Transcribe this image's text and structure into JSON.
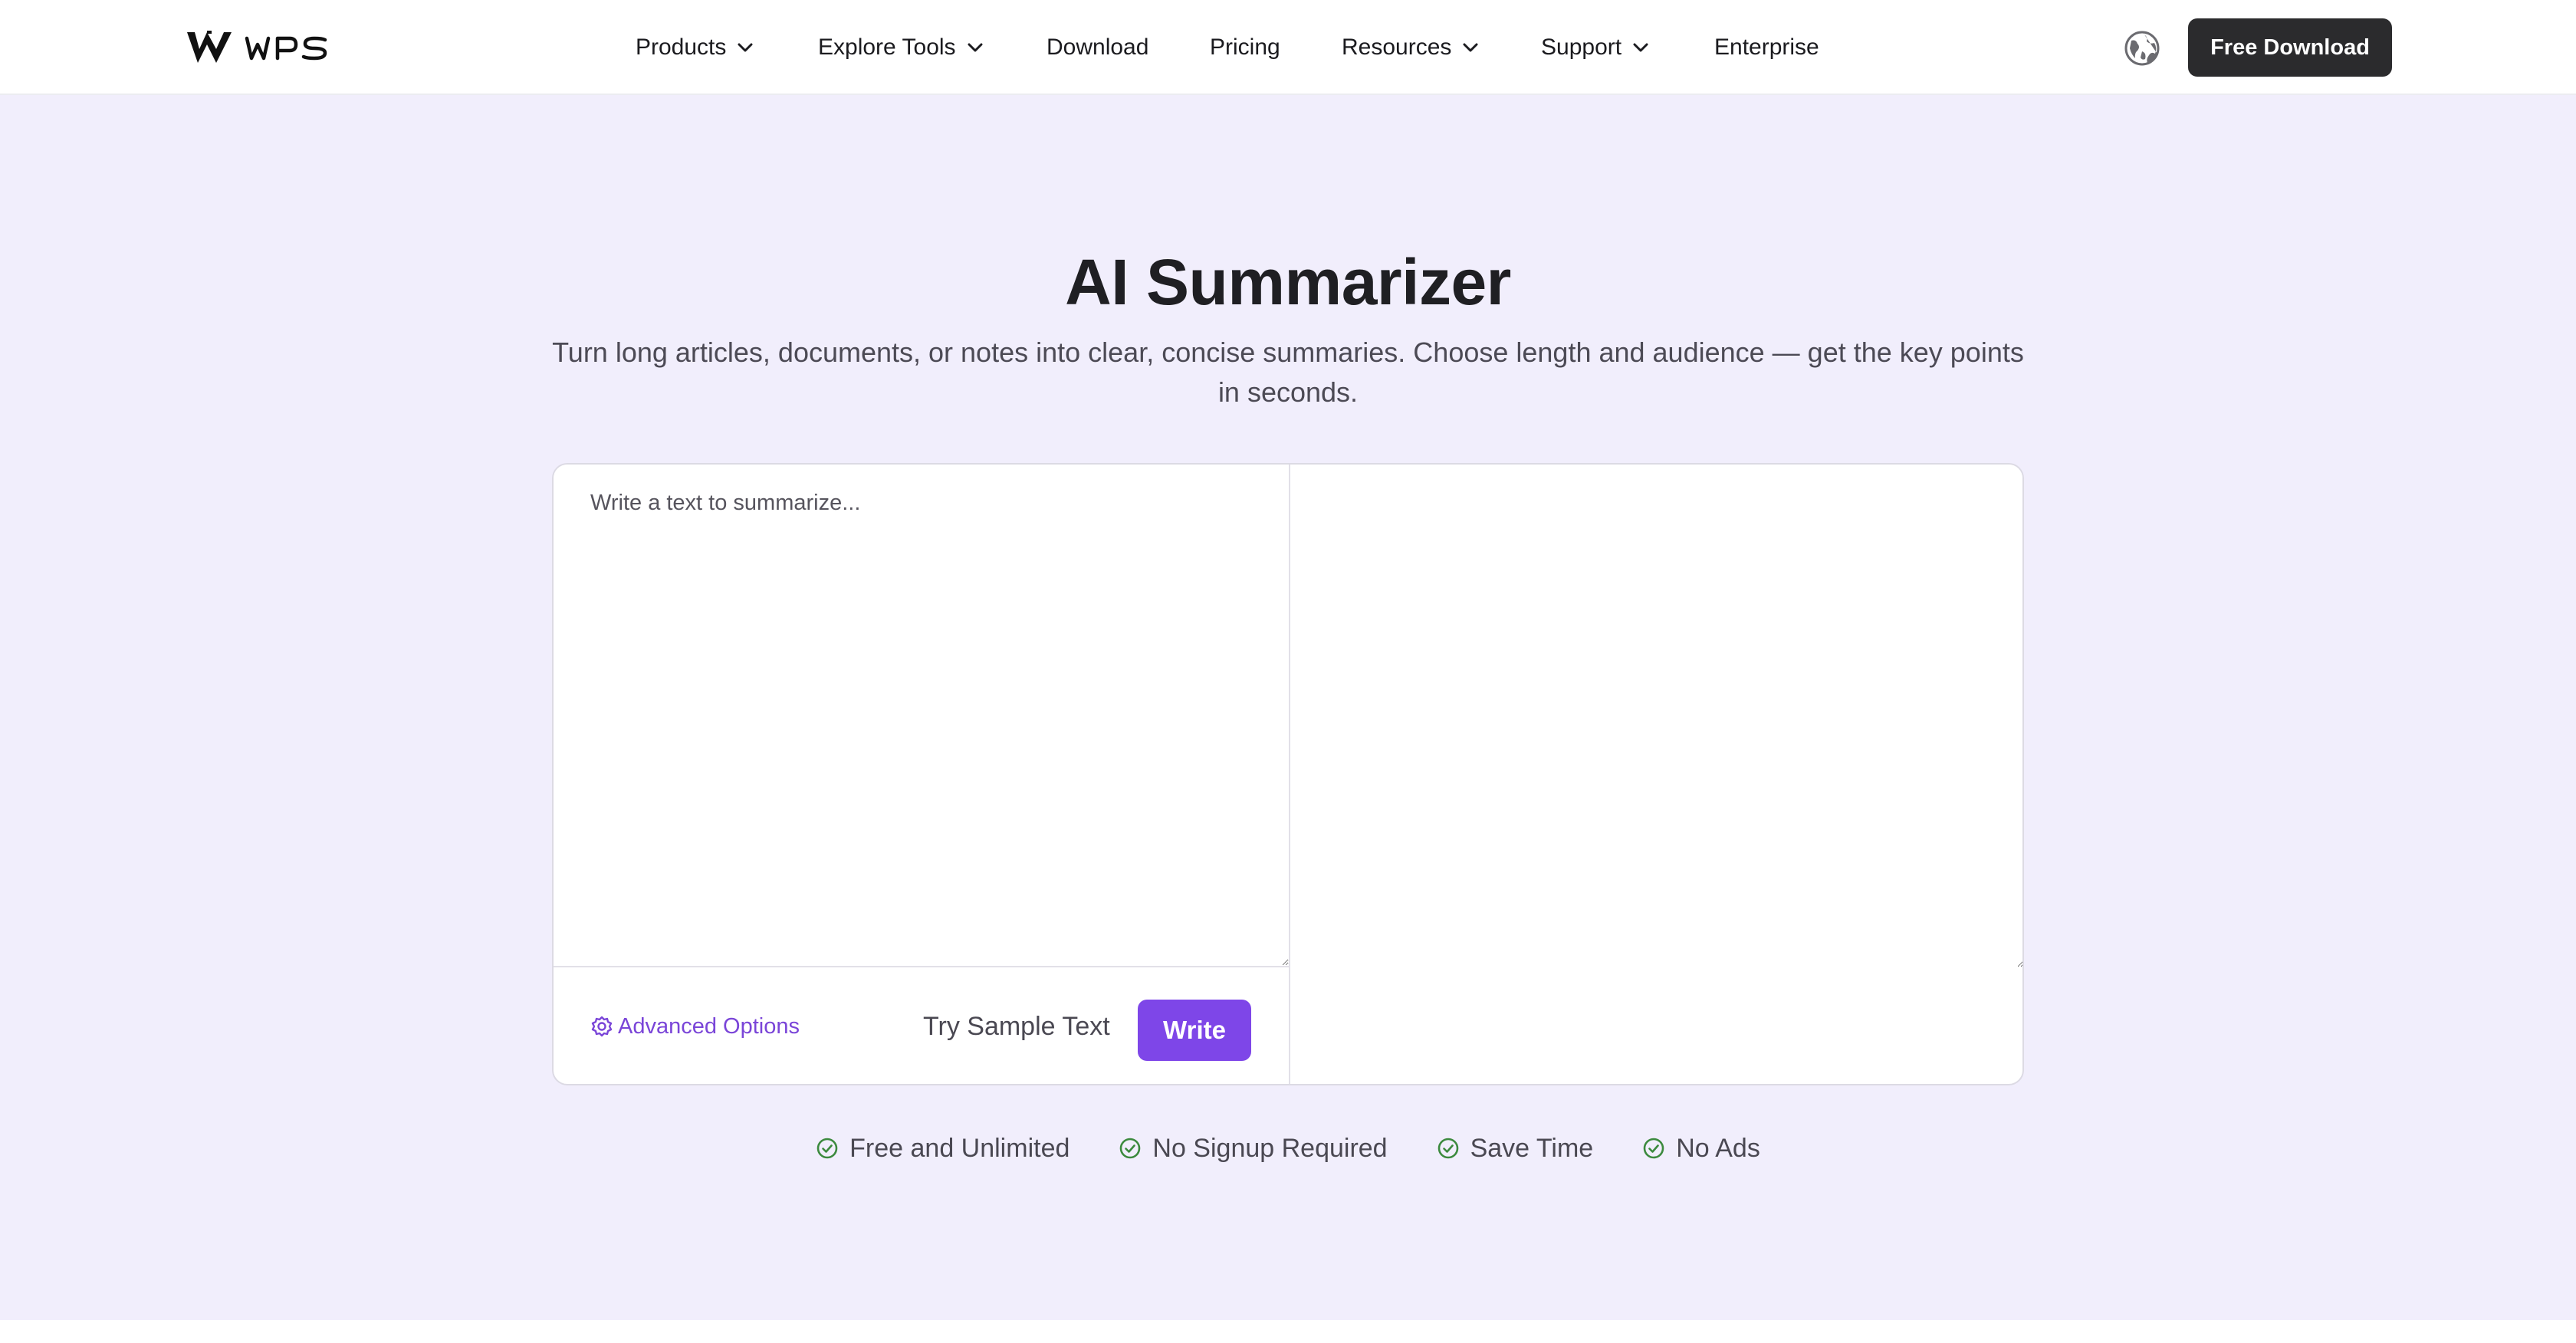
{
  "header": {
    "logo_text": "WPS",
    "nav": [
      {
        "label": "Products",
        "has_dropdown": true
      },
      {
        "label": "Explore Tools",
        "has_dropdown": true
      },
      {
        "label": "Download",
        "has_dropdown": false
      },
      {
        "label": "Pricing",
        "has_dropdown": false
      },
      {
        "label": "Resources",
        "has_dropdown": true
      },
      {
        "label": "Support",
        "has_dropdown": true
      },
      {
        "label": "Enterprise",
        "has_dropdown": false
      }
    ],
    "language_icon": "globe-icon",
    "cta_label": "Free Download"
  },
  "hero": {
    "title": "AI Summarizer",
    "subtitle": "Turn long articles, documents, or notes into clear, concise summaries. Choose length and audience — get the key points in seconds."
  },
  "editor": {
    "input_placeholder": "Write a text to summarize...",
    "input_value": "",
    "output_value": "",
    "advanced_options_label": "Advanced Options",
    "try_sample_label": "Try Sample Text",
    "write_label": "Write"
  },
  "features": [
    {
      "label": "Free and Unlimited",
      "icon": "check-circle-icon"
    },
    {
      "label": "No Signup Required",
      "icon": "check-circle-icon"
    },
    {
      "label": "Save Time",
      "icon": "check-circle-icon"
    },
    {
      "label": "No Ads",
      "icon": "check-circle-icon"
    }
  ],
  "colors": {
    "accent": "#7e46e8",
    "hero_background": "#f1eefc",
    "cta_background": "#2b2b2d",
    "check_green": "#3c8a3e"
  }
}
